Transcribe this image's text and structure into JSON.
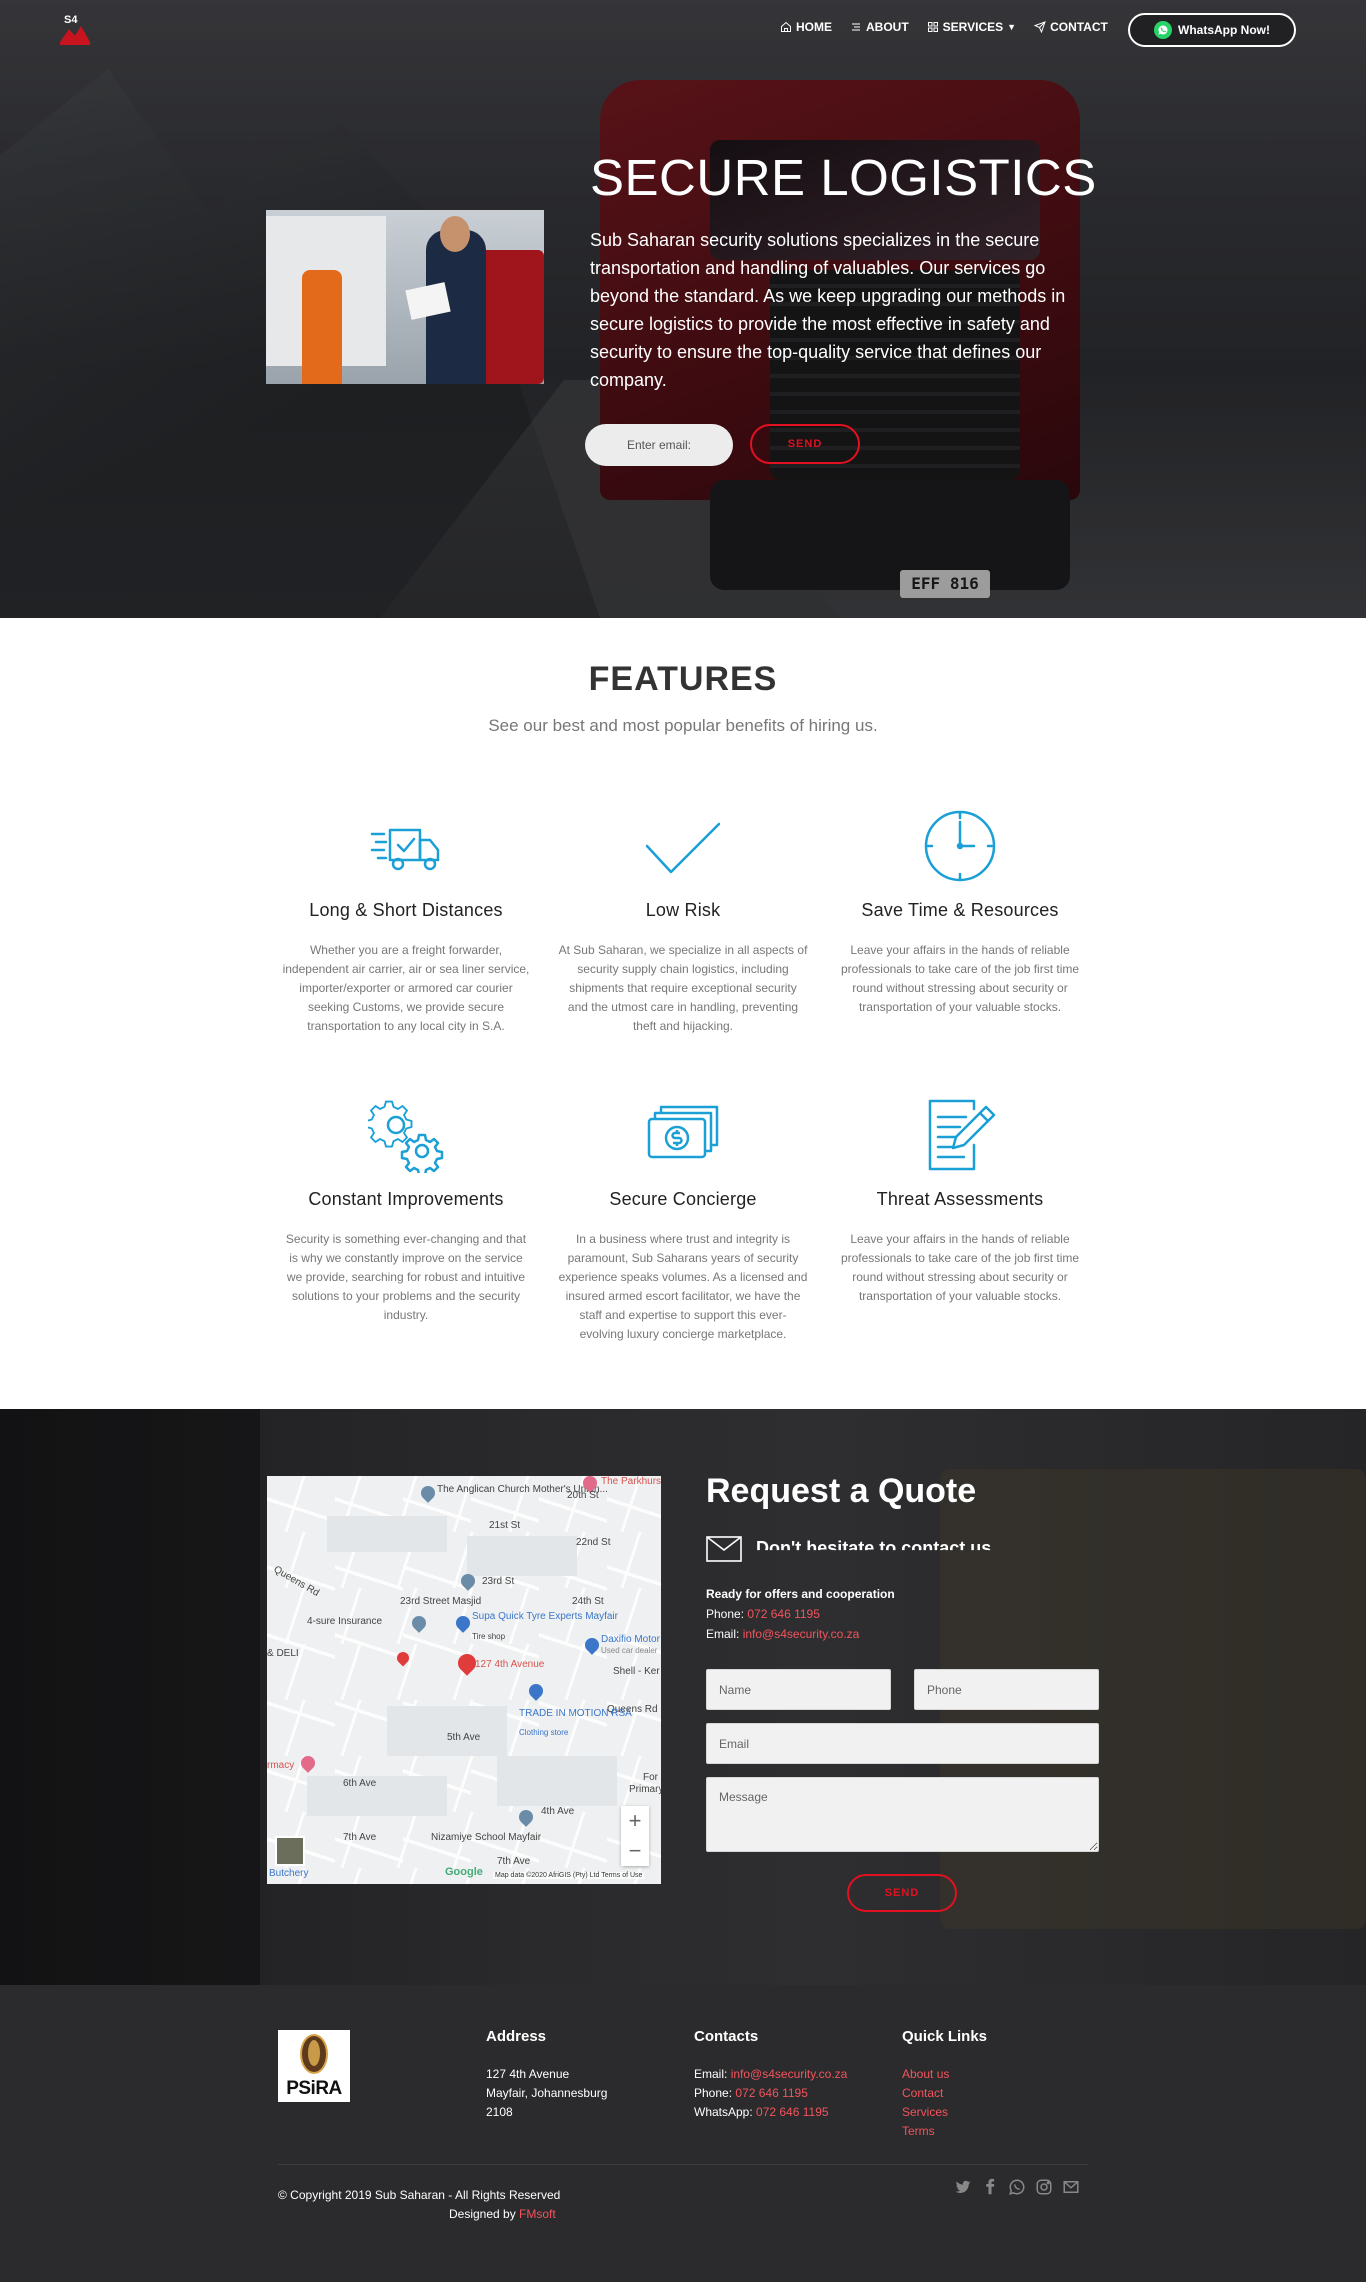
{
  "nav": {
    "logo_text": "S4",
    "items": [
      {
        "label": "HOME",
        "icon": "home-icon"
      },
      {
        "label": "ABOUT",
        "icon": "list-icon"
      },
      {
        "label": "SERVICES",
        "icon": "grid-icon"
      },
      {
        "label": "CONTACT",
        "icon": "send-icon"
      }
    ],
    "whatsapp_label": "WhatsApp Now!"
  },
  "hero": {
    "title": "SECURE LOGISTICS",
    "text": "Sub Saharan security solutions specializes in the secure transportation and handling of valuables. Our services go beyond the standard. As we keep upgrading our methods in secure logistics to provide the most effective in safety and security to ensure the top-quality service that defines our company.",
    "email_placeholder": "Enter email:",
    "send_label": "SEND",
    "plate": "EFF 816"
  },
  "features": {
    "title": "FEATURES",
    "subtitle": "See our best and most popular benefits of hiring us.",
    "items": [
      {
        "icon": "truck-icon",
        "title": "Long & Short Distances",
        "text": "Whether you are a freight forwarder, independent air carrier, air or sea liner service, importer/exporter or armored car courier seeking Customs, we provide secure transportation to any local city in S.A."
      },
      {
        "icon": "checkmark-icon",
        "title": "Low Risk",
        "text": "At Sub Saharan, we specialize in all aspects of security supply chain logistics, including shipments that require exceptional security and the utmost care in handling, preventing theft and hijacking."
      },
      {
        "icon": "clock-icon",
        "title": "Save Time & Resources",
        "text": "Leave your affairs in the hands of reliable professionals to take care of the job first time round without stressing about security or transportation of your valuable stocks."
      },
      {
        "icon": "gears-icon",
        "title": "Constant Improvements",
        "text": "Security is something ever-changing and that is why we constantly improve on the service we provide, searching for robust and intuitive solutions to your problems and the security industry."
      },
      {
        "icon": "money-icon",
        "title": "Secure Concierge",
        "text": "In a business where trust and integrity is paramount, Sub Saharans years of security experience speaks volumes. As a licensed and insured armed escort facilitator, we have the staff and expertise to support this ever-evolving luxury concierge marketplace."
      },
      {
        "icon": "document-edit-icon",
        "title": "Threat Assessments",
        "text": "Leave your affairs in the hands of reliable professionals to take care of the job first time round without stressing about security or transportation of your valuable stocks."
      }
    ]
  },
  "map": {
    "labels": {
      "church": "The Anglican Church Mother's Union...",
      "parkhurst": "The Parkhurst",
      "st21": "21st St",
      "st22": "22nd St",
      "st23": "23rd St",
      "st24": "24th St",
      "st20": "20th St",
      "masjid": "23rd Street Masjid",
      "sure": "4-sure Insurance",
      "supa": "Supa Quick Tyre Experts Mayfair",
      "supa_sub": "Tire shop",
      "daxifio": "Daxifio Motor",
      "daxifio_sub": "Used car dealer",
      "queens": "Queens Rd",
      "queens2": "Queens Rd",
      "deli": "& DELI",
      "ave127": "127 4th Avenue",
      "shell": "Shell - Ker",
      "trade": "TRADE IN MOTION RSA",
      "trade_sub": "Clothing store",
      "ave5": "5th Ave",
      "ave4": "4th Ave",
      "ave6": "6th Ave",
      "ave7": "7th Ave",
      "ave7b": "7th Ave",
      "pharmacy": "rmacy",
      "nizamiye": "Nizamiye School Mayfair",
      "butchery": "Butchery",
      "for": "For",
      "primary": "Primary S"
    },
    "google": "Google",
    "attribution": "Map data ©2020 AfriGIS (Pty) Ltd   Terms of Use",
    "zoom_in": "+",
    "zoom_out": "−"
  },
  "quote": {
    "title": "Request a Quote",
    "subtitle": "Don't hesitate to contact us",
    "ready": "Ready for offers and cooperation",
    "phone_label": "Phone: ",
    "phone": "072 646 1195",
    "email_label": "Email: ",
    "email": "info@s4security.co.za",
    "name_placeholder": "Name",
    "phone_placeholder": "Phone",
    "email_placeholder": "Email",
    "message_placeholder": "Message",
    "send_label": "SEND"
  },
  "footer": {
    "psira_text": "PSiRA",
    "address": {
      "title": "Address",
      "lines": [
        "127 4th Avenue",
        "Mayfair, Johannesburg",
        "2108"
      ]
    },
    "contacts": {
      "title": "Contacts",
      "email_label": "Email: ",
      "email": "info@s4security.co.za",
      "phone_label": "Phone: ",
      "phone": "072 646 1195",
      "whatsapp_label": "WhatsApp: ",
      "whatsapp": "072 646 1195"
    },
    "quick_links": {
      "title": "Quick Links",
      "items": [
        "About us",
        "Contact",
        "Services",
        "Terms"
      ]
    },
    "copyright": "© Copyright 2019 Sub Saharan - All Rights Reserved",
    "designed_by": "Designed by ",
    "designer": "FMsoft",
    "socials": [
      "twitter-icon",
      "facebook-icon",
      "whatsapp-icon",
      "instagram-icon",
      "mail-icon"
    ]
  },
  "colors": {
    "accent_red": "#e3111f",
    "link_red": "#f2545b",
    "icon_blue": "#1a9fd6",
    "footer_bg": "#2b2b2d",
    "whatsapp_green": "#25d366"
  }
}
